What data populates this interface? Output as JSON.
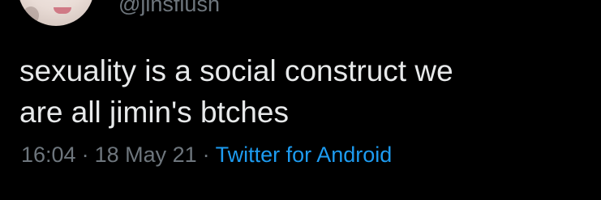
{
  "tweet": {
    "handle": "@jinsflush",
    "text": "sexuality is a social construct we\nare all jimin's btches",
    "time": "16:04",
    "separator": "·",
    "date": "18 May 21",
    "source": "Twitter for Android"
  },
  "colors": {
    "background": "#000000",
    "text": "#e7e9ea",
    "secondary": "#6e767d",
    "link": "#1d9bf0"
  }
}
